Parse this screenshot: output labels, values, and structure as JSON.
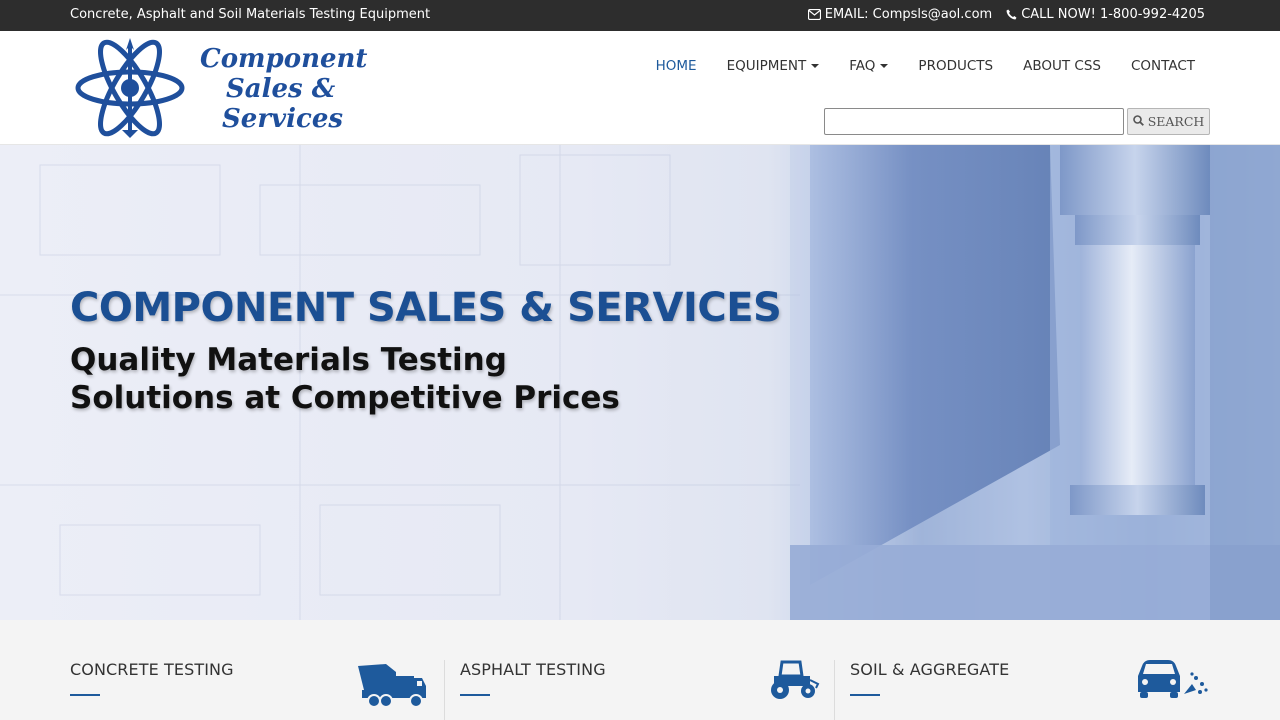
{
  "topbar": {
    "tagline": "Concrete, Asphalt and Soil Materials Testing Equipment",
    "email_label": "EMAIL: Compsls@aol.com",
    "phone_label": "CALL NOW! 1-800-992-4205",
    "email_icon": "envelope-icon",
    "phone_icon": "phone-icon"
  },
  "logo": {
    "line1": "Component",
    "line2": "Sales &",
    "line3": "Services"
  },
  "nav": {
    "items": [
      {
        "label": "HOME",
        "active": true
      },
      {
        "label": "EQUIPMENT",
        "dropdown": true
      },
      {
        "label": "FAQ",
        "dropdown": true
      },
      {
        "label": "PRODUCTS"
      },
      {
        "label": "ABOUT CSS"
      },
      {
        "label": "CONTACT"
      }
    ]
  },
  "search": {
    "value": "",
    "button_label": "SEARCH",
    "button_icon": "search-icon"
  },
  "hero": {
    "title": "COMPONENT SALES & SERVICES",
    "subtitle_line1": "Quality Materials Testing",
    "subtitle_line2": "Solutions at Competitive Prices"
  },
  "categories": [
    {
      "label": "CONCRETE TESTING",
      "icon": "cement-mixer-truck-icon"
    },
    {
      "label": "ASPHALT TESTING",
      "icon": "road-roller-icon"
    },
    {
      "label": "SOIL & AGGREGATE",
      "icon": "car-gravel-icon"
    }
  ],
  "colors": {
    "brand_blue": "#1e5a9c",
    "topbar_bg": "#2d2d2d",
    "hero_title": "#1b4f93",
    "category_bg": "#f4f4f4"
  }
}
